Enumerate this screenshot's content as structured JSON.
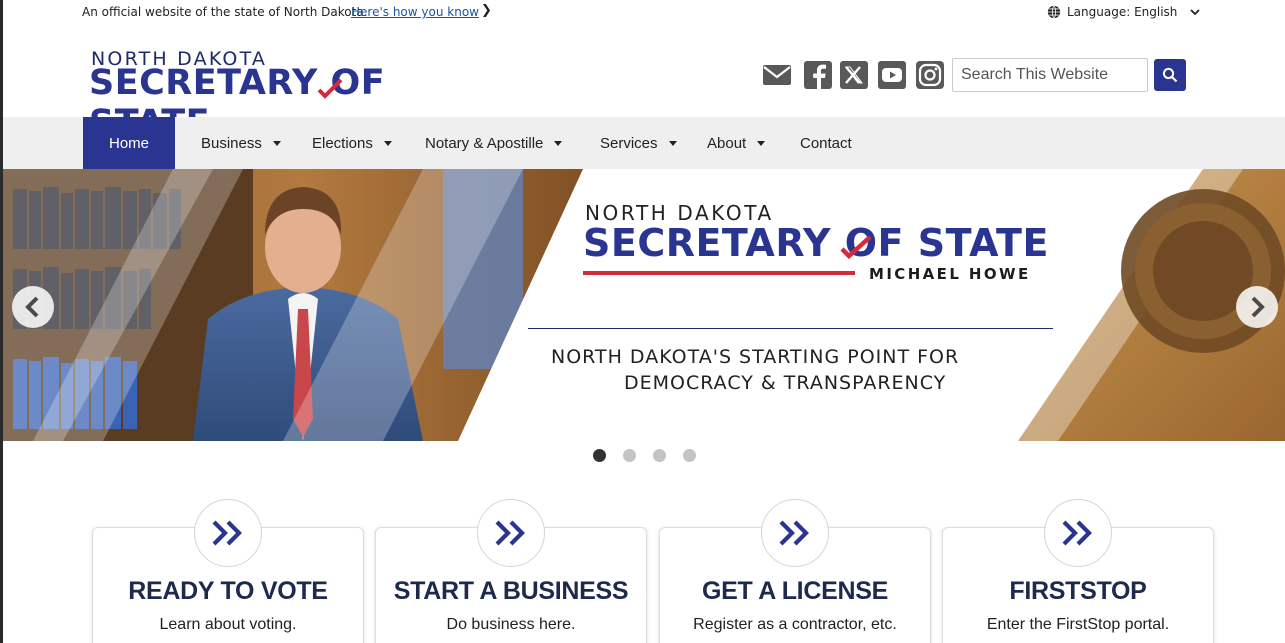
{
  "official_bar": {
    "text": "An official website of the state of North Dakota.",
    "link": "Here's how you know",
    "chevron": "❯",
    "language_label": "Language: English"
  },
  "logo": {
    "top": "NORTH DAKOTA",
    "main": "SECRETARY OF STATE"
  },
  "social_icons": [
    "email-icon",
    "facebook-icon",
    "x-icon",
    "youtube-icon",
    "instagram-icon"
  ],
  "search": {
    "placeholder": "Search This Website"
  },
  "nav": {
    "items": [
      {
        "label": "Home",
        "active": true
      },
      {
        "label": "Business",
        "dropdown": true
      },
      {
        "label": "Elections",
        "dropdown": true
      },
      {
        "label": "Notary & Apostille",
        "dropdown": true
      },
      {
        "label": "Services",
        "dropdown": true
      },
      {
        "label": "About",
        "dropdown": true
      },
      {
        "label": "Contact"
      }
    ]
  },
  "hero": {
    "logo_top": "NORTH DAKOTA",
    "logo_main": "SECRETARY OF STATE",
    "name": "MICHAEL HOWE",
    "tagline_1": "NORTH DAKOTA'S STARTING POINT FOR",
    "tagline_2": "DEMOCRACY & TRANSPARENCY",
    "slide_count": 4,
    "active_slide": 1
  },
  "cards": [
    {
      "title": "READY TO VOTE",
      "desc": "Learn about voting."
    },
    {
      "title": "START A BUSINESS",
      "desc": "Do business here."
    },
    {
      "title": "GET A LICENSE",
      "desc": "Register as a contractor, etc."
    },
    {
      "title": "FIRSTSTOP",
      "desc": "Enter the FirstStop portal."
    }
  ],
  "colors": {
    "brand_blue": "#2a3591",
    "accent_red": "#d22b3b",
    "nav_bg": "#efefef"
  }
}
